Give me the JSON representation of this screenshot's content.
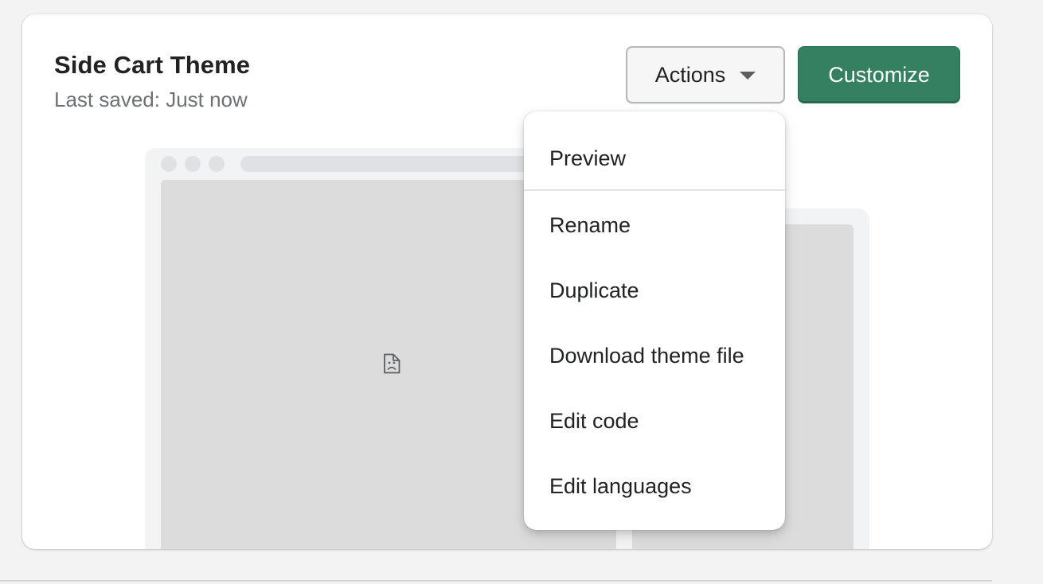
{
  "theme": {
    "title": "Side Cart Theme",
    "last_saved": "Last saved: Just now"
  },
  "buttons": {
    "actions_label": "Actions",
    "customize_label": "Customize"
  },
  "menu": {
    "items": [
      {
        "label": "Preview"
      },
      {
        "label": "Rename"
      },
      {
        "label": "Duplicate"
      },
      {
        "label": "Download theme file"
      },
      {
        "label": "Edit code"
      },
      {
        "label": "Edit languages"
      }
    ]
  },
  "colors": {
    "primary_button": "#348060",
    "page_background": "#f3f3f3",
    "card_background": "#ffffff",
    "preview_placeholder": "#dcdcdc"
  },
  "icons": {
    "actions_caret": "caret-down-icon",
    "preview_image": "broken-image-icon"
  }
}
